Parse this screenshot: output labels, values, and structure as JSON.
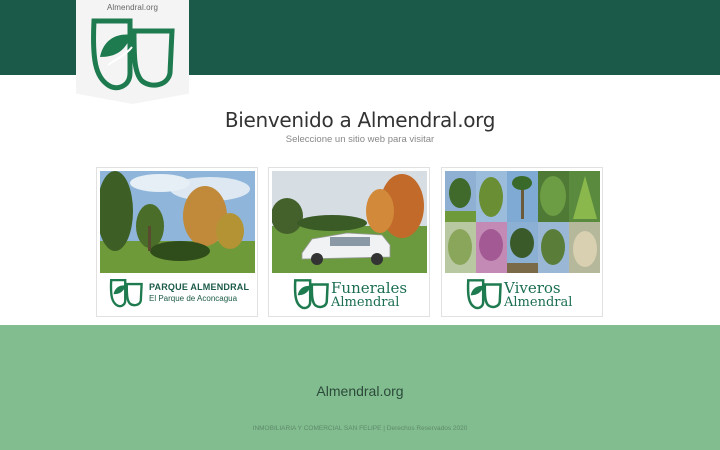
{
  "header": {
    "logo_text": "Almendral.org",
    "bg_color": "#1b5a48",
    "logo_icon": "almendral-leaf-logo-icon"
  },
  "main": {
    "title": "Bienvenido a Almendral.org",
    "subtitle": "Seleccione un sitio web para visitar"
  },
  "cards": [
    {
      "line1": "PARQUE ALMENDRAL",
      "line2": "El Parque de Aconcagua",
      "photo": "park-photo"
    },
    {
      "line1": "Funerales",
      "line2": "Almendral",
      "photo": "hearse-photo"
    },
    {
      "line1": "Viveros",
      "line2": "Almendral",
      "photo": "nursery-collage-photo"
    }
  ],
  "footer": {
    "site": "Almendral.org",
    "copyright": "INMOBILIARIA Y COMERCIAL SAN FELIPE | Derechos Reservados 2020",
    "bg_color": "#82bd8f"
  }
}
